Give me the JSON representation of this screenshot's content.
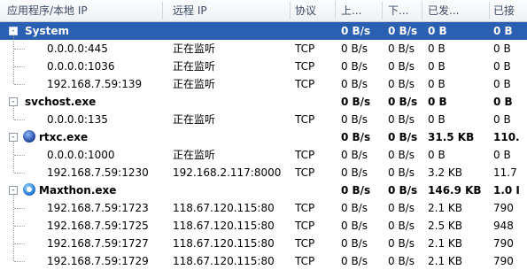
{
  "columns": [
    "应用程序/本地 IP",
    "远程 IP",
    "协议",
    "上...",
    "下...",
    "已发...",
    "已接"
  ],
  "groups": [
    {
      "name": "System",
      "expander": "-",
      "selected": true,
      "totals": [
        "0 B/s",
        "0 B/s",
        "0 B",
        "0 B"
      ],
      "icon": "",
      "children": [
        [
          "0.0.0.0:445",
          "正在监听",
          "TCP",
          "0 B/s",
          "0 B/s",
          "0 B",
          "0 B"
        ],
        [
          "0.0.0.0:1036",
          "正在监听",
          "TCP",
          "0 B/s",
          "0 B/s",
          "0 B",
          "0 B"
        ],
        [
          "192.168.7.59:139",
          "正在监听",
          "TCP",
          "0 B/s",
          "0 B/s",
          "0 B",
          "0 B"
        ]
      ]
    },
    {
      "name": "svchost.exe",
      "expander": "-",
      "selected": false,
      "totals": [
        "0 B/s",
        "0 B/s",
        "0 B",
        "0 B"
      ],
      "icon": "",
      "children": [
        [
          "0.0.0.0:135",
          "正在监听",
          "TCP",
          "0 B/s",
          "0 B/s",
          "0 B",
          "0 B"
        ]
      ]
    },
    {
      "name": "rtxc.exe",
      "expander": "-",
      "selected": false,
      "totals": [
        "0 B/s",
        "0 B/s",
        "31.5 KB",
        "110."
      ],
      "icon": "rtxc",
      "children": [
        [
          "0.0.0.0:1000",
          "正在监听",
          "TCP",
          "0 B/s",
          "0 B/s",
          "0 B",
          "0 B"
        ],
        [
          "192.168.7.59:1230",
          "192.168.2.117:8000",
          "TCP",
          "0 B/s",
          "0 B/s",
          "3.2 KB",
          "11.7"
        ]
      ]
    },
    {
      "name": "Maxthon.exe",
      "expander": "-",
      "selected": false,
      "totals": [
        "0 B/s",
        "0 B/s",
        "146.9 KB",
        "1.0 I"
      ],
      "icon": "maxthon",
      "children": [
        [
          "192.168.7.59:1723",
          "118.67.120.115:80",
          "TCP",
          "0 B/s",
          "0 B/s",
          "2.1 KB",
          "790"
        ],
        [
          "192.168.7.59:1725",
          "118.67.120.115:80",
          "TCP",
          "0 B/s",
          "0 B/s",
          "2.5 KB",
          "948"
        ],
        [
          "192.168.7.59:1727",
          "118.67.120.115:80",
          "TCP",
          "0 B/s",
          "0 B/s",
          "2.1 KB",
          "790"
        ],
        [
          "192.168.7.59:1729",
          "118.67.120.115:80",
          "TCP",
          "0 B/s",
          "0 B/s",
          "2.1 KB",
          "790"
        ]
      ]
    }
  ]
}
